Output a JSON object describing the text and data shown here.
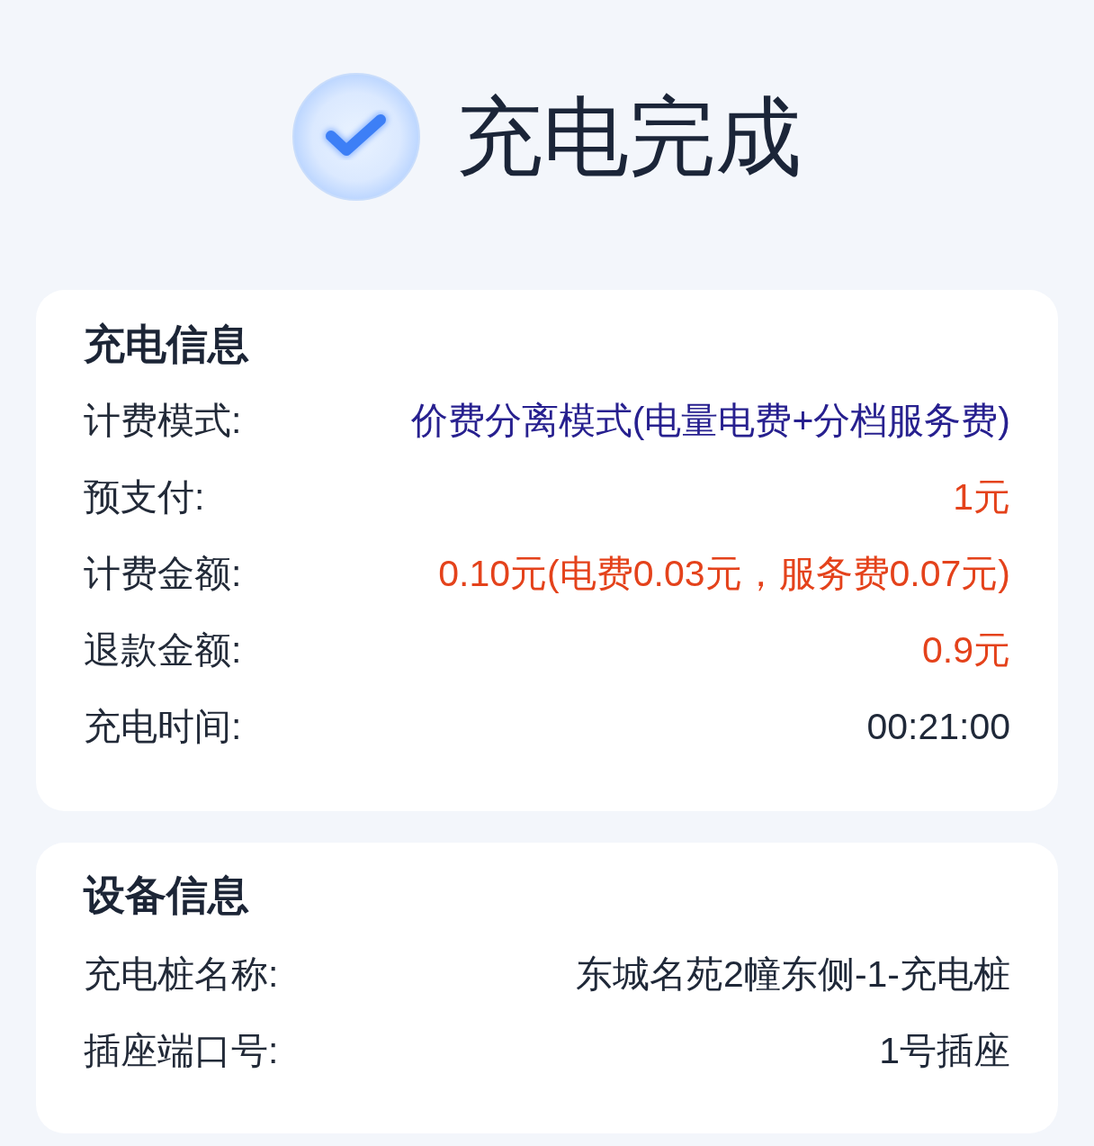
{
  "header": {
    "title": "充电完成"
  },
  "sections": [
    {
      "title": "充电信息",
      "rows": [
        {
          "label": "计费模式:",
          "value": "价费分离模式(电量电费+分档服务费)",
          "kind": "mode"
        },
        {
          "label": "预支付:",
          "value": "1元",
          "kind": "money"
        },
        {
          "label": "计费金额:",
          "value": "0.10元(电费0.03元，服务费0.07元)",
          "kind": "money"
        },
        {
          "label": "退款金额:",
          "value": "0.9元",
          "kind": "money"
        },
        {
          "label": "充电时间:",
          "value": "00:21:00",
          "kind": "plain"
        }
      ]
    },
    {
      "title": "设备信息",
      "rows": [
        {
          "label": "充电桩名称:",
          "value": "东城名苑2幢东侧-1-充电桩",
          "kind": "plain"
        },
        {
          "label": "插座端口号:",
          "value": "1号插座",
          "kind": "plain"
        }
      ]
    }
  ]
}
